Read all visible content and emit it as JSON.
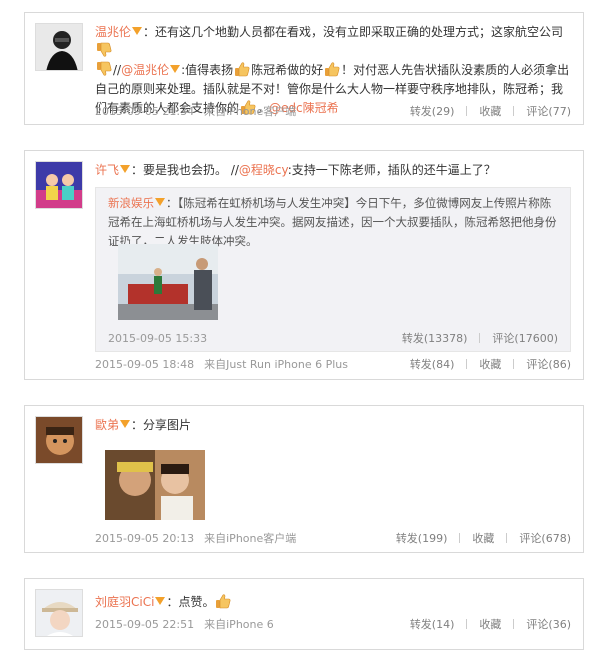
{
  "posts": [
    {
      "user": "温兆伦",
      "text_1": "：还有这几个地勤人员都在看戏，没有立即采取正确的处理方式；这家航空公司",
      "text_2": "//",
      "mention_1": "@温兆伦",
      "text_3": ":值得表扬",
      "text_4": "陈冠希做的好",
      "text_5": "！对付恶人先告状插队没素质的人必须拿出自己的原则来处理。插队就是不对！管你是什么大人物一样要守秩序地排队，陈冠希；我们有素质的人都会支持你的",
      "mention_2": "@edc陳冠希",
      "time": "2015-09-05 21:34",
      "source": "来自iPhone客户端",
      "repost": "转发(29)",
      "fav": "收藏",
      "comment": "评论(77)"
    },
    {
      "user": "许飞",
      "text_1": "：要是我也会扔。 //",
      "mention_1": "@程晓cy",
      "text_2": ":支持一下陈老师，插队的还牛逼上了？",
      "quote_user": "新浪娱乐",
      "quote_text": "：【陈冠希在虹桥机场与人发生冲突】今日下午，多位微博网友上传照片称陈冠希在上海虹桥机场与人发生冲突。据网友描述，因一个大叔要插队，陈冠希怒把他身份证扔了，二人发生肢体冲突。",
      "quote_time": "2015-09-05 15:33",
      "quote_repost": "转发(13378)",
      "quote_comment": "评论(17600)",
      "time": "2015-09-05 18:48",
      "source": "来自Just Run iPhone 6 Plus",
      "repost": "转发(84)",
      "fav": "收藏",
      "comment": "评论(86)"
    },
    {
      "user": "歐弟",
      "text_1": "：分享图片",
      "time": "2015-09-05 20:13",
      "source": "来自iPhone客户端",
      "repost": "转发(199)",
      "fav": "收藏",
      "comment": "评论(678)"
    },
    {
      "user": "刘庭羽CiCi",
      "text_1": "：点赞。",
      "time": "2015-09-05 22:51",
      "source": "来自iPhone 6",
      "repost": "转发(14)",
      "fav": "收藏",
      "comment": "评论(36)"
    }
  ],
  "icons": {
    "verified": "v-badge-icon",
    "thumb_up": "thumb-up-emoji",
    "thumb_down": "thumb-down-emoji"
  },
  "colors": {
    "username": "#eb7350",
    "meta": "#999999",
    "quote_bg": "#f2f2f5",
    "border": "#d9d9d9"
  }
}
